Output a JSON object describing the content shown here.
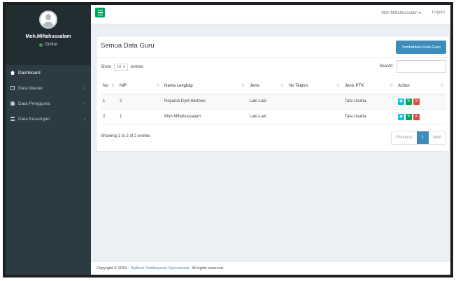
{
  "sidebar": {
    "user_name": "Moh.Miftahussalam",
    "status": "Online",
    "menu": [
      {
        "label": "Dashboard",
        "icon": "home-icon"
      },
      {
        "label": "Data Master",
        "icon": "grid-icon"
      },
      {
        "label": "Data Pengguna",
        "icon": "user-icon"
      },
      {
        "label": "Data Keuangan",
        "icon": "table-icon"
      }
    ]
  },
  "topbar": {
    "user": "Moh.Miftahussalam",
    "logout": "Logout"
  },
  "box": {
    "title": "Semua Data Guru",
    "add_button": "Tambahkan Data Guru",
    "show_label": "Show",
    "show_value": "10",
    "entries_label": "entries",
    "search_label": "Search:"
  },
  "table": {
    "headers": [
      "No",
      "NIP",
      "Nama Lengkap",
      "Jenis",
      "No Telpon",
      "Jenis PTK",
      "Action"
    ],
    "rows": [
      {
        "no": "1",
        "nip": "2",
        "nama": "Noyandi Dyid Hertono",
        "jenis": "Laki-Laki",
        "telpon": "",
        "ptk": "Tata Usaha"
      },
      {
        "no": "2",
        "nip": "1",
        "nama": "Moh.Miftahussalam",
        "jenis": "Laki-Laki",
        "telpon": "",
        "ptk": "Tata Usaha"
      }
    ]
  },
  "pagination": {
    "info": "Showing 1 to 2 of 2 entries",
    "previous": "Previous",
    "current": "1",
    "next": "Next"
  },
  "footer": {
    "copyright": "Copyright © 2018 -",
    "app_name": "Aplikasi Pembayaran Operasional.",
    "rights": "All rights reserved."
  },
  "colors": {
    "sidebar": "#2c3b41",
    "primary": "#3c8dbc",
    "success": "#00a65a",
    "info": "#00c0ef",
    "danger": "#dd4b39"
  }
}
